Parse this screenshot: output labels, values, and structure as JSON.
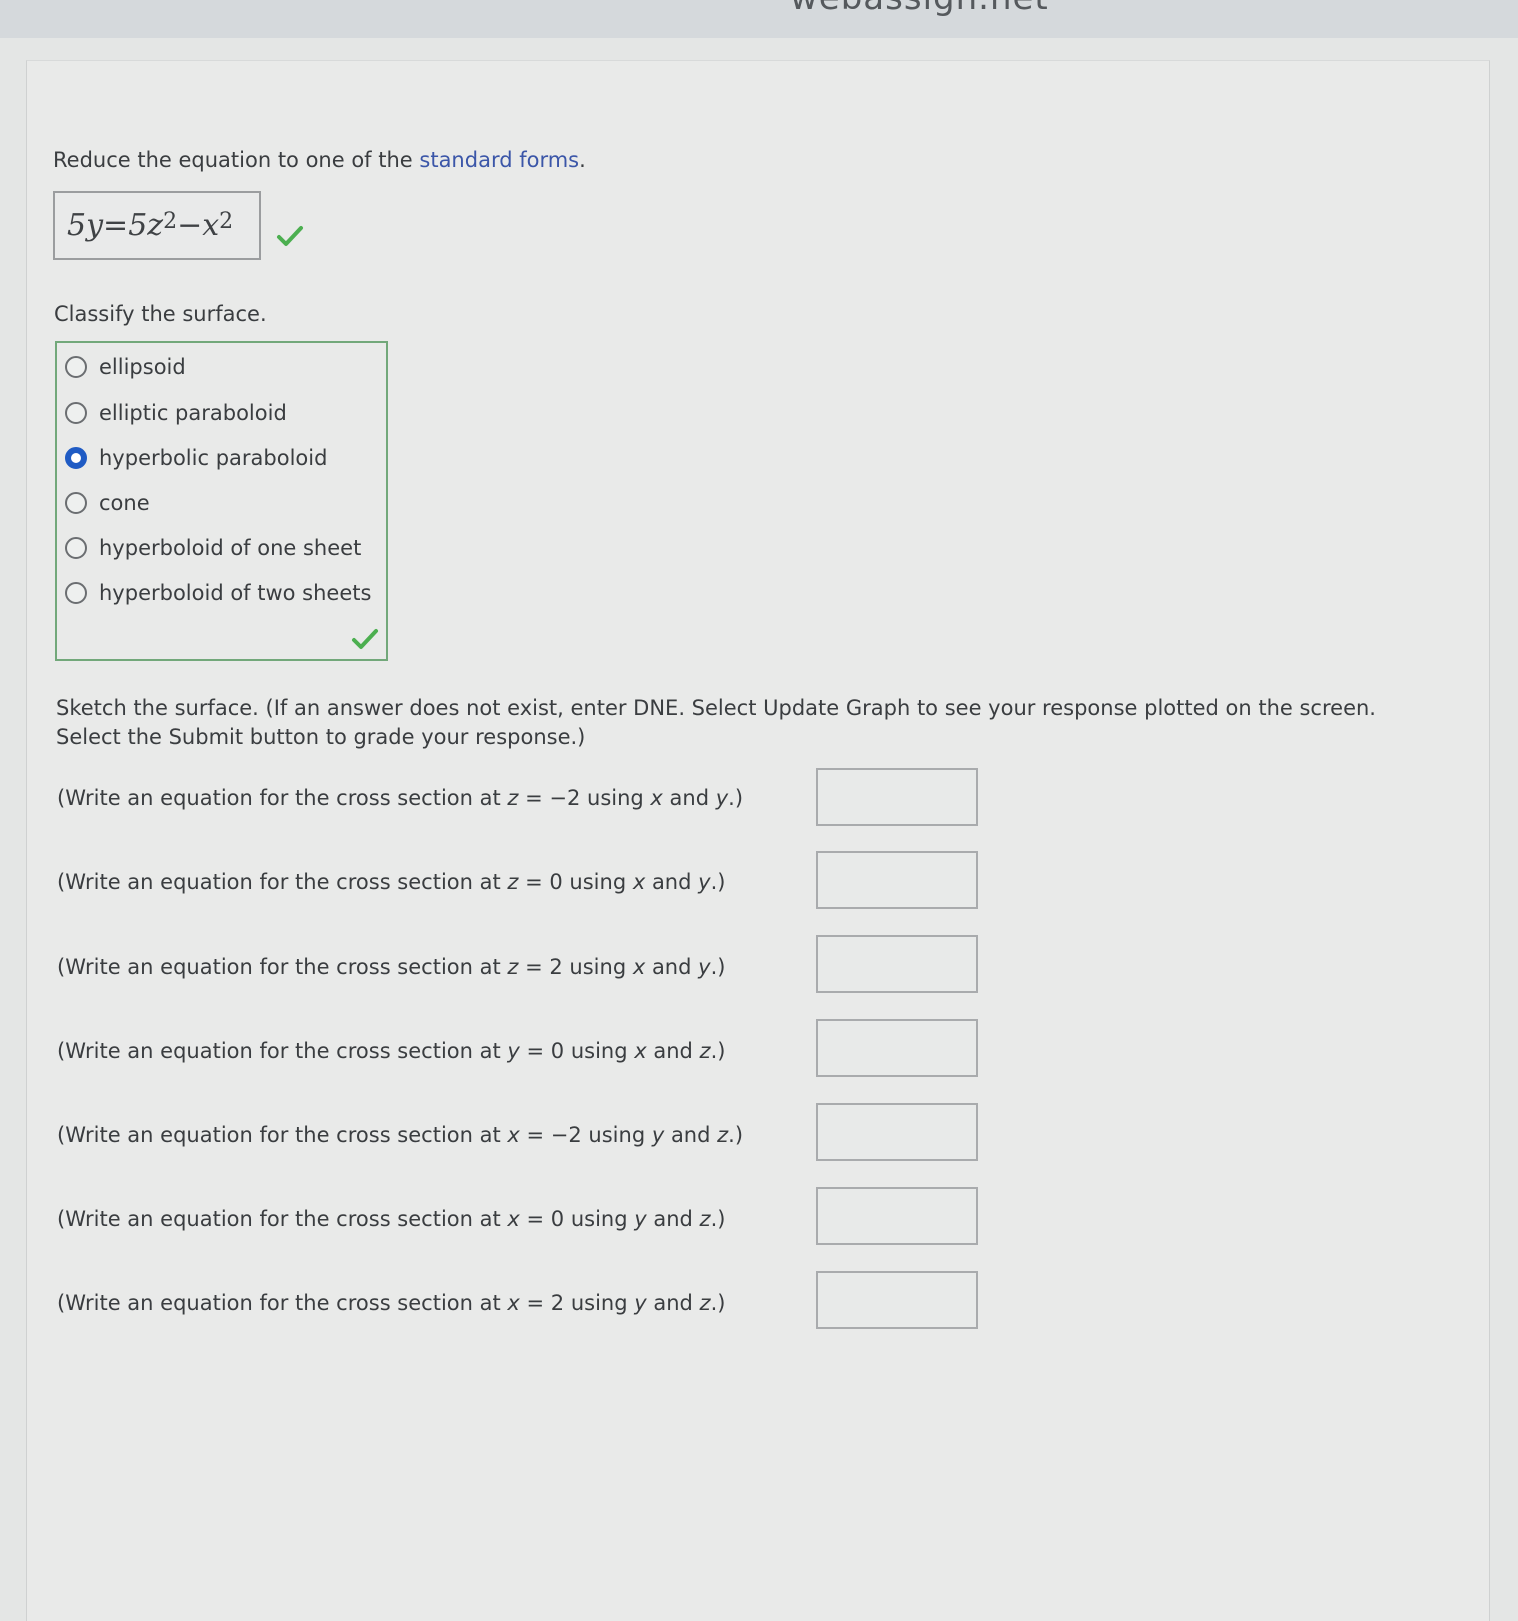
{
  "browser": {
    "site": "webassign.net"
  },
  "question": {
    "intro_text": "Reduce the equation to one of the ",
    "link_text": "standard forms",
    "intro_end": ".",
    "equation": {
      "lhs": "5y",
      "eq": " = ",
      "a": "5z",
      "exp1": "2",
      "minus": " − ",
      "b": "x",
      "exp2": "2"
    },
    "classify_label": "Classify the surface.",
    "options": [
      {
        "label": "ellipsoid",
        "selected": false
      },
      {
        "label": "elliptic paraboloid",
        "selected": false
      },
      {
        "label": "hyperbolic paraboloid",
        "selected": true
      },
      {
        "label": "cone",
        "selected": false
      },
      {
        "label": "hyperboloid of one sheet",
        "selected": false
      },
      {
        "label": "hyperboloid of two sheets",
        "selected": false
      }
    ],
    "sketch_line1": "Sketch the surface. (If an answer does not exist, enter DNE. Select Update Graph to see your response plotted on the screen.",
    "sketch_line2": "Select the Submit button to grade your response.)",
    "cross_sections": [
      {
        "pre": "(Write an equation for the cross section at ",
        "var": "z",
        "eq": " = −2 using ",
        "v1": "x",
        "and": " and ",
        "v2": "y",
        "end": ".)",
        "value": ""
      },
      {
        "pre": "(Write an equation for the cross section at ",
        "var": "z",
        "eq": " = 0 using ",
        "v1": "x",
        "and": " and ",
        "v2": "y",
        "end": ".)",
        "value": ""
      },
      {
        "pre": "(Write an equation for the cross section at ",
        "var": "z",
        "eq": " = 2 using ",
        "v1": "x",
        "and": " and ",
        "v2": "y",
        "end": ".)",
        "value": ""
      },
      {
        "pre": "(Write an equation for the cross section at ",
        "var": "y",
        "eq": " = 0 using ",
        "v1": "x",
        "and": " and ",
        "v2": "z",
        "end": ".)",
        "value": ""
      },
      {
        "pre": "(Write an equation for the cross section at ",
        "var": "x",
        "eq": " = −2 using ",
        "v1": "y",
        "and": " and ",
        "v2": "z",
        "end": ".)",
        "value": ""
      },
      {
        "pre": "(Write an equation for the cross section at ",
        "var": "x",
        "eq": " = 0 using ",
        "v1": "y",
        "and": " and ",
        "v2": "z",
        "end": ".)",
        "value": ""
      },
      {
        "pre": "(Write an equation for the cross section at ",
        "var": "x",
        "eq": " = 2 using ",
        "v1": "y",
        "and": " and ",
        "v2": "z",
        "end": ".)",
        "value": ""
      }
    ]
  },
  "colors": {
    "correct": "#4caf50",
    "link": "#3b56a8",
    "selected_radio": "#1f5bc4"
  }
}
